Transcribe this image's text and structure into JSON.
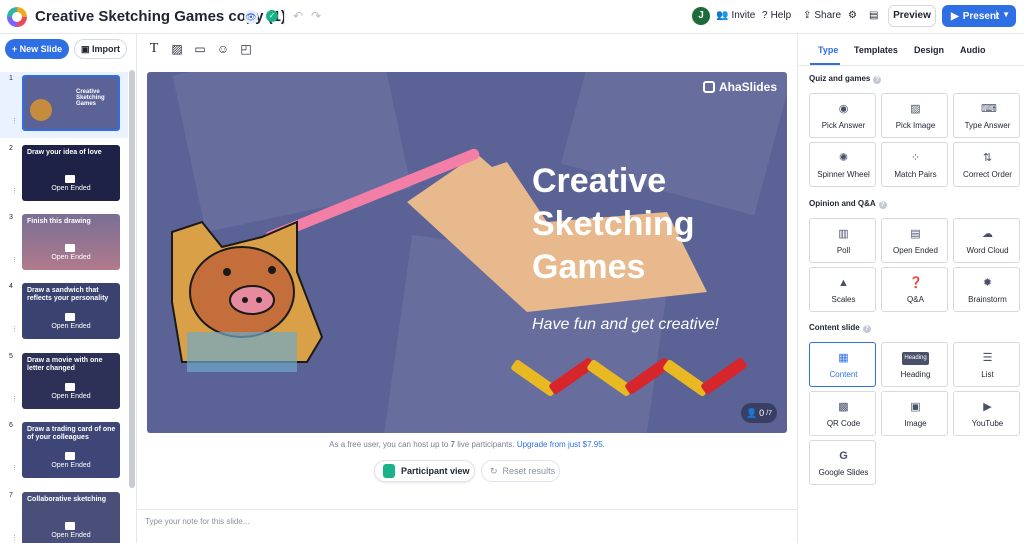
{
  "header": {
    "doc_title": "Creative Sketching Games copy (1)",
    "avatar_initial": "J",
    "invite_label": "Invite",
    "help_label": "Help",
    "share_label": "Share",
    "preview_label": "Preview",
    "present_label": "Present"
  },
  "sidebar": {
    "new_slide_label": "+ New Slide",
    "import_label": "Import",
    "slides": [
      {
        "num": "1",
        "title": "Creative Sketching Games",
        "sub": ""
      },
      {
        "num": "2",
        "title": "Draw your idea of love",
        "sub": "Open Ended"
      },
      {
        "num": "3",
        "title": "Finish this drawing",
        "sub": "Open Ended"
      },
      {
        "num": "4",
        "title": "Draw a sandwich that reflects your personality",
        "sub": "Open Ended"
      },
      {
        "num": "5",
        "title": "Draw a movie with one letter changed",
        "sub": "Open Ended"
      },
      {
        "num": "6",
        "title": "Draw a trading card of one of your colleagues",
        "sub": "Open Ended"
      },
      {
        "num": "7",
        "title": "Collaborative sketching",
        "sub": "Open Ended"
      }
    ]
  },
  "slide": {
    "brand": "AhaSlides",
    "title_line1": "Creative",
    "title_line2": "Sketching",
    "title_line3": "Games",
    "subtitle": "Have fun and get creative!",
    "participants": "0",
    "participants_total": "/7"
  },
  "footer": {
    "notice_prefix": "As a free user, you can host up to ",
    "notice_count": "7",
    "notice_mid": " live participants. ",
    "notice_link": "Upgrade from just $7.95.",
    "participant_view_label": "Participant view",
    "reset_results_label": "Reset results",
    "note_placeholder": "Type your note for this slide..."
  },
  "panel": {
    "tabs": [
      "Type",
      "Templates",
      "Design",
      "Audio"
    ],
    "quiz_title": "Quiz and games",
    "quiz_items": [
      {
        "label": "Pick Answer",
        "icon": "pick-answer-icon"
      },
      {
        "label": "Pick Image",
        "icon": "pick-image-icon"
      },
      {
        "label": "Type Answer",
        "icon": "keyboard-icon"
      },
      {
        "label": "Spinner Wheel",
        "icon": "spinner-wheel-icon"
      },
      {
        "label": "Match Pairs",
        "icon": "match-pairs-icon"
      },
      {
        "label": "Correct Order",
        "icon": "correct-order-icon"
      }
    ],
    "opinion_title": "Opinion and Q&A",
    "opinion_items": [
      {
        "label": "Poll",
        "icon": "poll-icon"
      },
      {
        "label": "Open Ended",
        "icon": "open-ended-icon"
      },
      {
        "label": "Word Cloud",
        "icon": "cloud-icon"
      },
      {
        "label": "Scales",
        "icon": "scales-icon"
      },
      {
        "label": "Q&A",
        "icon": "qa-icon"
      },
      {
        "label": "Brainstorm",
        "icon": "lightbulb-icon"
      }
    ],
    "content_title": "Content slide",
    "content_items": [
      {
        "label": "Content",
        "icon": "content-icon"
      },
      {
        "label": "Heading",
        "icon": "heading-icon",
        "badge": "Heading"
      },
      {
        "label": "List",
        "icon": "list-icon"
      },
      {
        "label": "QR Code",
        "icon": "qr-code-icon"
      },
      {
        "label": "Image",
        "icon": "image-icon"
      },
      {
        "label": "YouTube",
        "icon": "youtube-icon"
      },
      {
        "label": "Google Slides",
        "icon": "google-icon",
        "glyph": "G"
      }
    ]
  },
  "colors": {
    "accent": "#2f6fe4",
    "slide_bg": "#5b6296",
    "success": "#1bb28a"
  }
}
